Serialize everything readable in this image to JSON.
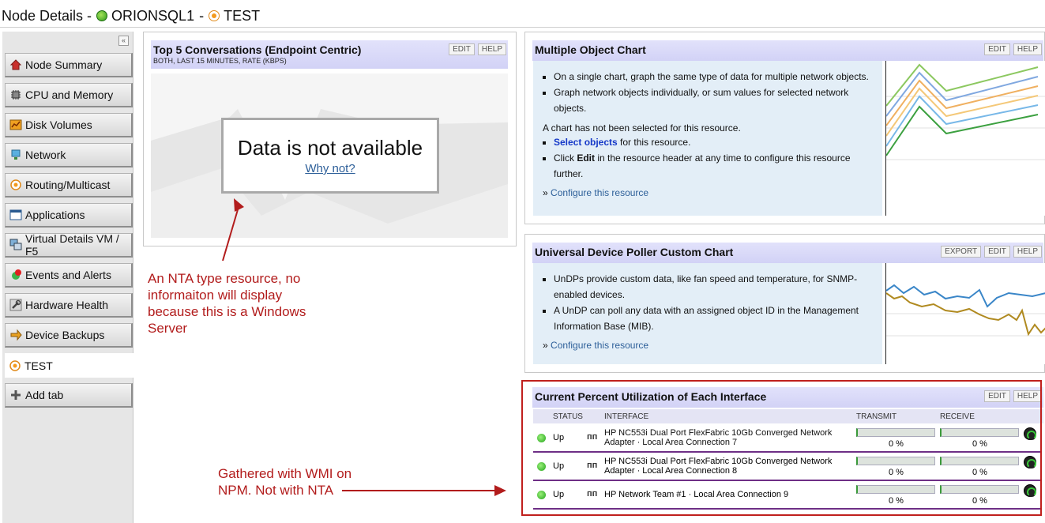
{
  "header": {
    "title_prefix": "Node Details -",
    "node_name": "ORIONSQL1",
    "separator": "-",
    "tab_name": "TEST"
  },
  "sidebar": {
    "collapse_label": "«",
    "tabs": [
      {
        "label": "Node Summary",
        "icon": "house-icon"
      },
      {
        "label": "CPU and Memory",
        "icon": "chip-icon"
      },
      {
        "label": "Disk Volumes",
        "icon": "chart-icon"
      },
      {
        "label": "Network",
        "icon": "network-icon"
      },
      {
        "label": "Routing/Multicast",
        "icon": "routing-icon"
      },
      {
        "label": "Applications",
        "icon": "window-icon"
      },
      {
        "label": "Virtual Details VM / F5",
        "icon": "vm-icon"
      },
      {
        "label": "Events and Alerts",
        "icon": "alert-icon"
      },
      {
        "label": "Hardware Health",
        "icon": "wrench-icon"
      },
      {
        "label": "Device Backups",
        "icon": "backup-icon"
      },
      {
        "label": "TEST",
        "icon": "routing-icon"
      },
      {
        "label": "Add tab",
        "icon": "plus-icon"
      }
    ]
  },
  "nta": {
    "title": "Top 5 Conversations (Endpoint Centric)",
    "subtitle": "BOTH, LAST 15 MINUTES, RATE (KBPS)",
    "edit": "EDIT",
    "help": "HELP",
    "nodata_title": "Data is not available",
    "nodata_link": "Why not?"
  },
  "multi_chart": {
    "title": "Multiple Object Chart",
    "edit": "EDIT",
    "help": "HELP",
    "bullet1": "On a single chart, graph the same type of data for multiple network objects.",
    "bullet2": "Graph network objects individually, or sum values for selected network objects.",
    "note": "A chart has not been selected for this resource.",
    "select_link": "Select objects",
    "select_rest": " for this resource.",
    "click_pre": "Click ",
    "click_bold": "Edit",
    "click_rest": " in the resource header at any time to configure this resource further.",
    "configure_prefix": "»",
    "configure_link": "Configure this resource"
  },
  "udp_chart": {
    "title": "Universal Device Poller Custom Chart",
    "export": "EXPORT",
    "edit": "EDIT",
    "help": "HELP",
    "bullet1": "UnDPs provide custom data, like fan speed and temperature, for SNMP-enabled devices.",
    "bullet2": "A UnDP can poll any data with an assigned object ID in the Management Information Base (MIB).",
    "configure_prefix": "»",
    "configure_link": "Configure this resource"
  },
  "utilization": {
    "title": "Current Percent Utilization of Each Interface",
    "edit": "EDIT",
    "help": "HELP",
    "columns": {
      "status": "STATUS",
      "interface": "INTERFACE",
      "transmit": "TRANSMIT",
      "receive": "RECEIVE"
    },
    "rows": [
      {
        "status": "Up",
        "interface": "HP NC553i Dual Port FlexFabric 10Gb Converged Network Adapter · Local Area Connection 7",
        "transmit": "0 %",
        "receive": "0 %",
        "transmit_fraction": 0,
        "receive_fraction": 0
      },
      {
        "status": "Up",
        "interface": "HP NC553i Dual Port FlexFabric 10Gb Converged Network Adapter · Local Area Connection 8",
        "transmit": "0 %",
        "receive": "0 %",
        "transmit_fraction": 0,
        "receive_fraction": 0
      },
      {
        "status": "Up",
        "interface": "HP Network Team #1 · Local Area Connection 9",
        "transmit": "0 %",
        "receive": "0 %",
        "transmit_fraction": 0,
        "receive_fraction": 0
      }
    ]
  },
  "annotations": {
    "nta_note": "An NTA type resource, no informaiton will display because this is a Windows Server",
    "wmi_note": "Gathered with WMI on NPM.  Not with NTA"
  },
  "colors": {
    "title_bar": "#d6d6f8",
    "info_box": "#e3eef7",
    "annotation": "#b21c1c",
    "highlight_frame": "#c0201d",
    "row_divider": "#6e2f86"
  }
}
